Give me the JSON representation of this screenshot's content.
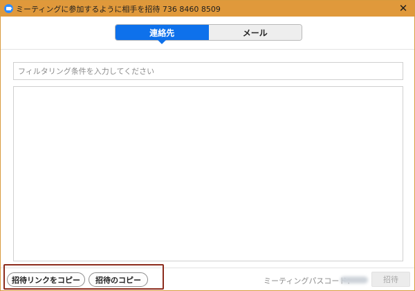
{
  "window": {
    "title": "ミーティングに参加するように相手を招待 736 8460 8509"
  },
  "tabs": [
    {
      "label": "連絡先",
      "active": true
    },
    {
      "label": "メール",
      "active": false
    }
  ],
  "filter": {
    "placeholder": "フィルタリング条件を入力してください",
    "value": ""
  },
  "footer": {
    "copy_link_label": "招待リンクをコピー",
    "copy_invite_label": "招待のコピー",
    "passcode_label": "ミーティングパスコード：",
    "invite_label": "招待"
  },
  "colors": {
    "titlebar": "#e0993b",
    "accent": "#0e71eb",
    "highlight": "#8b2a1a"
  },
  "icons": {
    "app": "zoom-camera-icon",
    "close": "close-icon"
  }
}
